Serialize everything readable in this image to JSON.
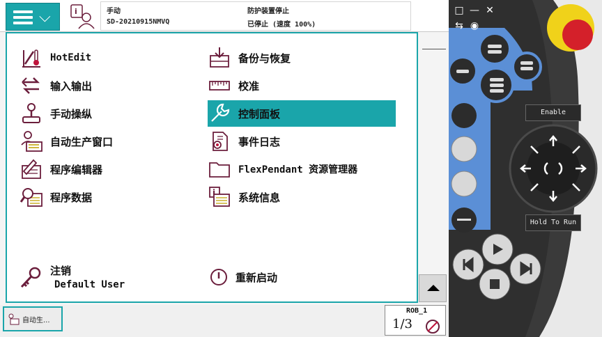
{
  "header": {
    "status": {
      "mode": "手动",
      "system": "SD-20210915NMVQ",
      "state": "防护装置停止",
      "speed": "已停止 (速度 100%)"
    }
  },
  "menu": {
    "left": [
      {
        "label": "HotEdit",
        "icon": "hotedit-icon"
      },
      {
        "label": "输入输出",
        "icon": "io-arrows-icon"
      },
      {
        "label": "手动操纵",
        "icon": "joystick-icon"
      },
      {
        "label": "自动生产窗口",
        "icon": "auto-production-icon"
      },
      {
        "label": "程序编辑器",
        "icon": "program-editor-icon"
      },
      {
        "label": "程序数据",
        "icon": "program-data-icon"
      }
    ],
    "right": [
      {
        "label": "备份与恢复",
        "icon": "backup-restore-icon"
      },
      {
        "label": "校准",
        "icon": "calibration-ruler-icon"
      },
      {
        "label": "控制面板",
        "icon": "wrench-icon",
        "selected": true
      },
      {
        "label": "事件日志",
        "icon": "event-log-icon"
      },
      {
        "label": "FlexPendant 资源管理器",
        "icon": "folder-icon"
      },
      {
        "label": "系统信息",
        "icon": "system-info-icon"
      }
    ],
    "logout": {
      "label": "注销",
      "user": "Default User"
    },
    "restart": {
      "label": "重新启动"
    }
  },
  "taskbar": {
    "task_label": "自动生...",
    "robot": {
      "name": "ROB_1",
      "fraction": "1/3"
    }
  },
  "device": {
    "enable_label": "Enable",
    "hold_label": "Hold To Run"
  },
  "colors": {
    "accent": "#1aa5aa",
    "icon": "#6b1e3c",
    "device_blue": "#5b8fd6",
    "device_dark": "#3c3c3c",
    "estop": "#d4202a",
    "estop_ring": "#f0d21a"
  }
}
